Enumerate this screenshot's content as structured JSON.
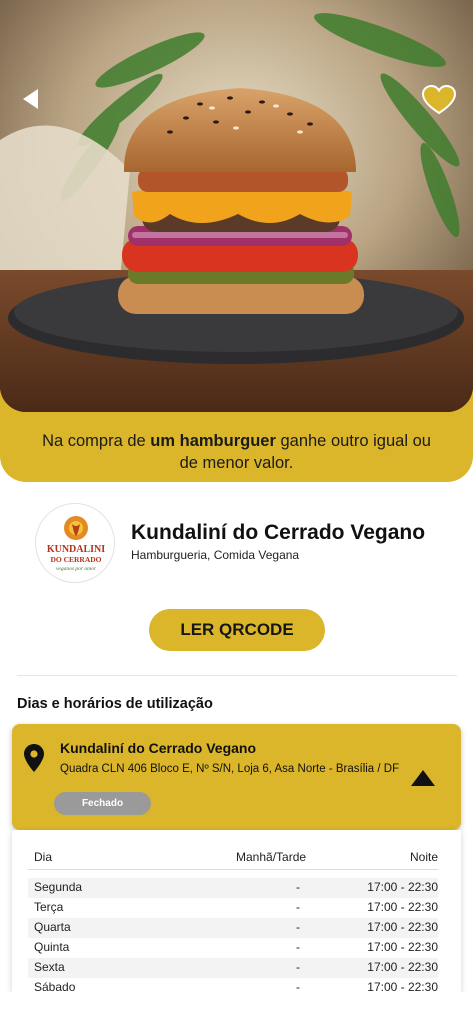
{
  "promo": {
    "text_before": "Na compra de ",
    "text_bold": "um hamburguer",
    "text_after": " ganhe outro igual ou de menor valor."
  },
  "store": {
    "name": "Kundaliní do Cerrado Vegano",
    "categories": "Hamburgueria, Comida Vegana",
    "logo_text_line1": "KUNDALINI",
    "logo_text_line2": "DO CERRADO",
    "logo_tagline": "veganos por amor"
  },
  "actions": {
    "qr_label": "LER QRCODE"
  },
  "schedule": {
    "section_title": "Dias e horários de utilização",
    "location": {
      "name": "Kundaliní do Cerrado Vegano",
      "address": "Quadra CLN 406 Bloco E, Nº S/N, Loja 6, Asa Norte - Brasília / DF",
      "status": "Fechado"
    },
    "headers": {
      "day": "Dia",
      "morning_afternoon": "Manhã/Tarde",
      "night": "Noite"
    },
    "rows": [
      {
        "day": "Segunda",
        "morning_afternoon": "-",
        "night": "17:00 - 22:30"
      },
      {
        "day": "Terça",
        "morning_afternoon": "-",
        "night": "17:00 - 22:30"
      },
      {
        "day": "Quarta",
        "morning_afternoon": "-",
        "night": "17:00 - 22:30"
      },
      {
        "day": "Quinta",
        "morning_afternoon": "-",
        "night": "17:00 - 22:30"
      },
      {
        "day": "Sexta",
        "morning_afternoon": "-",
        "night": "17:00 - 22:30"
      },
      {
        "day": "Sábado",
        "morning_afternoon": "-",
        "night": "17:00 - 22:30"
      }
    ]
  },
  "icons": {
    "back": "back-arrow-icon",
    "favorite": "heart-icon",
    "location": "map-pin-icon",
    "collapse": "triangle-up-icon"
  },
  "colors": {
    "accent": "#dbb62b",
    "status_closed": "#9a9a9a"
  }
}
